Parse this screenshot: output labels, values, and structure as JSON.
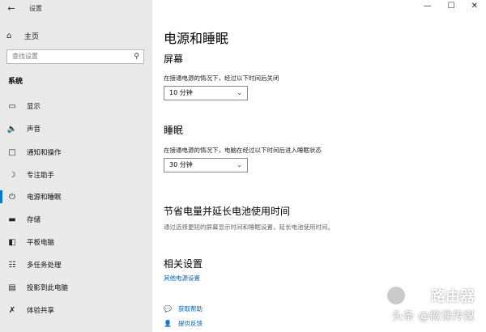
{
  "window": {
    "title": "设置",
    "back_icon": "arrow-left-icon"
  },
  "sidebar": {
    "home_label": "主页",
    "search_placeholder": "查找设置",
    "section_label": "系统",
    "items": [
      {
        "label": "显示",
        "icon": "monitor-icon"
      },
      {
        "label": "声音",
        "icon": "speaker-icon"
      },
      {
        "label": "通知和操作",
        "icon": "notification-icon"
      },
      {
        "label": "专注助手",
        "icon": "moon-icon"
      },
      {
        "label": "电源和睡眠",
        "icon": "power-icon",
        "active": true
      },
      {
        "label": "存储",
        "icon": "storage-icon"
      },
      {
        "label": "平板电脑",
        "icon": "tablet-icon"
      },
      {
        "label": "多任务处理",
        "icon": "multitask-icon"
      },
      {
        "label": "投影到此电脑",
        "icon": "project-icon"
      },
      {
        "label": "体验共享",
        "icon": "share-icon"
      }
    ],
    "accent": "#0078d7"
  },
  "main": {
    "title": "电源和睡眠",
    "screen": {
      "heading": "屏幕",
      "desc": "在接通电源的情况下，经过以下时间后关闭",
      "value": "10 分钟"
    },
    "sleep": {
      "heading": "睡眠",
      "desc": "在接通电源的情况下，电脑在经过以下时间后进入睡眠状态",
      "value": "30 分钟"
    },
    "battery": {
      "heading": "节省电量并延长电池使用时间",
      "desc": "通过选择更短的屏幕显示时间和睡眠设置，延长电池使用时间。"
    },
    "related": {
      "heading": "相关设置",
      "link": "其他电源设置"
    },
    "help": {
      "get_help": "获取帮助",
      "feedback": "提供反馈"
    }
  },
  "watermark": {
    "line1": "路由器",
    "line2": "头条 @微课传媒"
  }
}
